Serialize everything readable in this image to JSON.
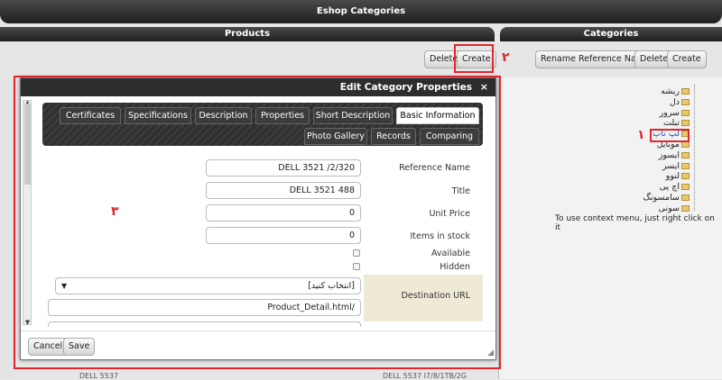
{
  "header": {
    "title": "Eshop Categories"
  },
  "products": {
    "title": "Products",
    "delete_label": "Delete",
    "create_label": "Create"
  },
  "categories": {
    "title": "Categories",
    "rename_label": "Rename Reference Name",
    "delete_label": "Delete",
    "create_label": "Create",
    "tree": [
      "ریشه",
      "دل",
      "سرور",
      "تبلت",
      "لپ تاپ",
      "موبایل",
      "ایسوز",
      "ایسر",
      "لنوو",
      "اچ پی",
      "سامسونگ",
      "سونی"
    ],
    "selected_index": 4,
    "context_hint": "To use context menu, just right click on it"
  },
  "annotations": {
    "one": "۱",
    "two": "۲",
    "three": "۳"
  },
  "background_rows": {
    "left": "DELL 5537",
    "right": "DELL 5537 I7/8/1TB/2G"
  },
  "modal": {
    "title": "Edit Category Properties",
    "close": "×",
    "tabs_row1": [
      "Certificates",
      "Specifications",
      "Description",
      "Properties",
      "Short Description",
      "Basic Information"
    ],
    "tabs_row2": [
      "Photo Gallery",
      "Records",
      "Comparing"
    ],
    "active_tab": "Basic Information",
    "labels": {
      "reference_name": "Reference Name",
      "title": "Title",
      "unit_price": "Unit Price",
      "items_in_stock": "Items in stock",
      "available": "Available",
      "hidden": "Hidden",
      "destination_url": "Destination URL"
    },
    "values": {
      "reference_name": "DELL 3521 /2/320",
      "title": "DELL 3521 488",
      "unit_price": "0",
      "items_in_stock": "0",
      "destination_select": "[انتخاب کنید]",
      "destination_url": "Product_Detail.html/"
    },
    "cancel_label": "Cancel",
    "save_label": "Save"
  }
}
